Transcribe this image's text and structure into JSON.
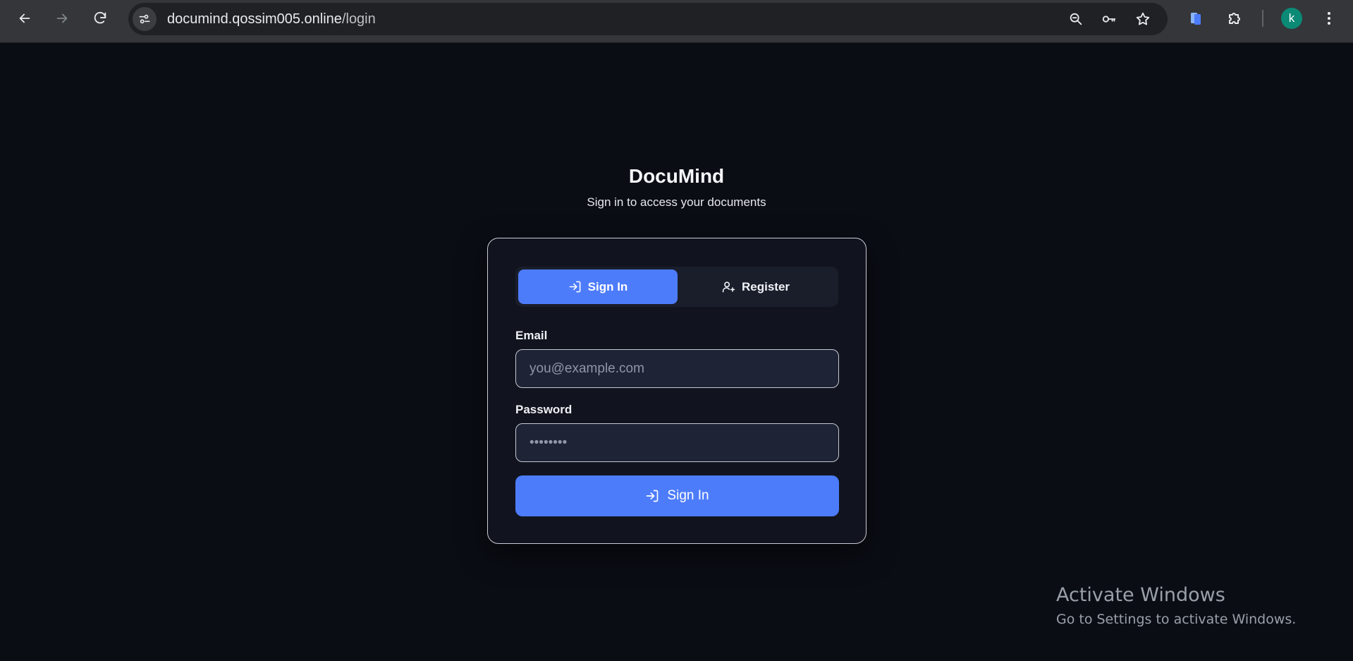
{
  "browser": {
    "url_host": "documind.qossim005.online",
    "url_path": "/login",
    "profile_initial": "k",
    "icons": [
      "back-arrow-icon",
      "forward-arrow-icon",
      "reload-icon",
      "site-settings-icon",
      "zoom-icon",
      "key-icon",
      "star-icon",
      "docs-extension-icon",
      "extensions-puzzle-icon",
      "kebab-menu-icon"
    ]
  },
  "app": {
    "title": "DocuMind",
    "subtitle": "Sign in to access your documents"
  },
  "tabs": [
    {
      "label": "Sign In",
      "icon": "sign-in-icon",
      "active": true
    },
    {
      "label": "Register",
      "icon": "user-plus-icon",
      "active": false
    }
  ],
  "form": {
    "email_label": "Email",
    "email_placeholder": "you@example.com",
    "password_label": "Password",
    "password_placeholder": "••••••••",
    "submit_label": "Sign In"
  },
  "watermark": {
    "title": "Activate Windows",
    "subtitle": "Go to Settings to activate Windows."
  },
  "colors": {
    "background": "#0a0d14",
    "card": "#11141e",
    "accent": "#4d7cfb",
    "input_bg": "#1e2335"
  }
}
